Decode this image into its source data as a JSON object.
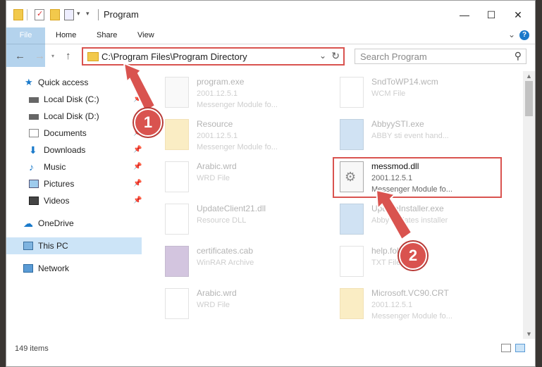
{
  "window": {
    "title": "Program",
    "controls": {
      "minimize": "—",
      "maximize": "☐",
      "close": "✕"
    }
  },
  "ribbon": {
    "tabs": [
      "File",
      "Home",
      "Share",
      "View"
    ],
    "help": "?"
  },
  "address": {
    "path": "C:\\Program Files\\Program Directory",
    "search_placeholder": "Search Program"
  },
  "sidebar": {
    "quick_access": "Quick access",
    "items": [
      {
        "label": "Local Disk (C:)",
        "pinned": true
      },
      {
        "label": "Local Disk (D:)",
        "pinned": true
      },
      {
        "label": "Documents",
        "pinned": true
      },
      {
        "label": "Downloads",
        "pinned": true
      },
      {
        "label": "Music",
        "pinned": true
      },
      {
        "label": "Pictures",
        "pinned": true
      },
      {
        "label": "Videos",
        "pinned": true
      }
    ],
    "onedrive": "OneDrive",
    "this_pc": "This PC",
    "network": "Network"
  },
  "files": [
    {
      "name": "program.exe",
      "line2": "2001.12.5.1",
      "line3": "Messenger Module fo..."
    },
    {
      "name": "SndToWP14.wcm",
      "line2": "WCM File",
      "line3": ""
    },
    {
      "name": "Resource",
      "line2": "2001.12.5.1",
      "line3": "Messenger Module fo..."
    },
    {
      "name": "AbbyySTI.exe",
      "line2": "ABBY sti event hand...",
      "line3": ""
    },
    {
      "name": "Arabic.wrd",
      "line2": "WRD File",
      "line3": ""
    },
    {
      "name": "messmod.dll",
      "line2": "2001.12.5.1",
      "line3": "Messenger Module fo..."
    },
    {
      "name": "UpdateClient21.dll",
      "line2": "Resource DLL",
      "line3": ""
    },
    {
      "name": "UpdateInstaller.exe",
      "line2": "Abby updates installer",
      "line3": ""
    },
    {
      "name": "certificates.cab",
      "line2": "WinRAR Archive",
      "line3": ""
    },
    {
      "name": "help.foldertxt",
      "line2": "TXT File",
      "line3": ""
    },
    {
      "name": "Arabic.wrd",
      "line2": "WRD File",
      "line3": ""
    },
    {
      "name": "Microsoft.VC90.CRT",
      "line2": "2001.12.5.1",
      "line3": "Messenger Module fo..."
    }
  ],
  "status": {
    "item_count": "149 items"
  },
  "annotations": {
    "step1": "1",
    "step2": "2"
  },
  "colors": {
    "accent": "#1979ca",
    "highlight": "#d9534f",
    "selected": "#cce4f7"
  }
}
